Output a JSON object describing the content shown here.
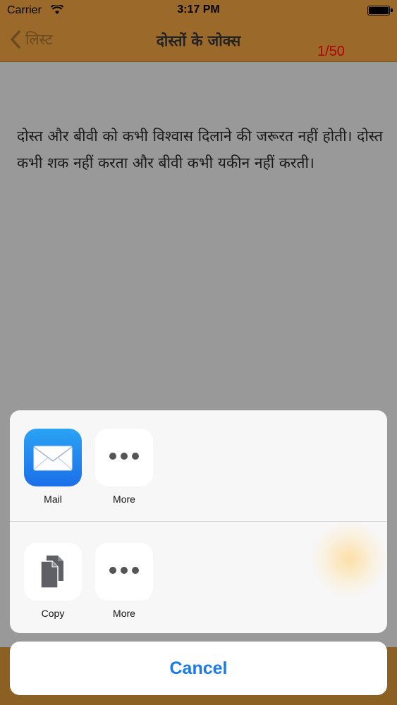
{
  "status_bar": {
    "carrier": "Carrier",
    "time": "3:17 PM"
  },
  "nav": {
    "back_label": "लिस्ट",
    "title": "दोस्तों के जोक्स",
    "counter": "1/50"
  },
  "joke": {
    "text": "दोस्त और बीवी को कभी विश्वास दिलाने की जरूरत नहीं होती। दोस्त कभी शक नहीं करता और बीवी कभी यकीन नहीं करती।"
  },
  "share_sheet": {
    "share_row": [
      {
        "label": "Mail",
        "icon": "mail-icon"
      },
      {
        "label": "More",
        "icon": "more-icon"
      }
    ],
    "action_row": [
      {
        "label": "Copy",
        "icon": "copy-icon"
      },
      {
        "label": "More",
        "icon": "more-icon"
      }
    ],
    "cancel_label": "Cancel"
  },
  "colors": {
    "bar": "#9b6a2a",
    "accent": "#1a7ae6",
    "counter": "#b00000"
  }
}
